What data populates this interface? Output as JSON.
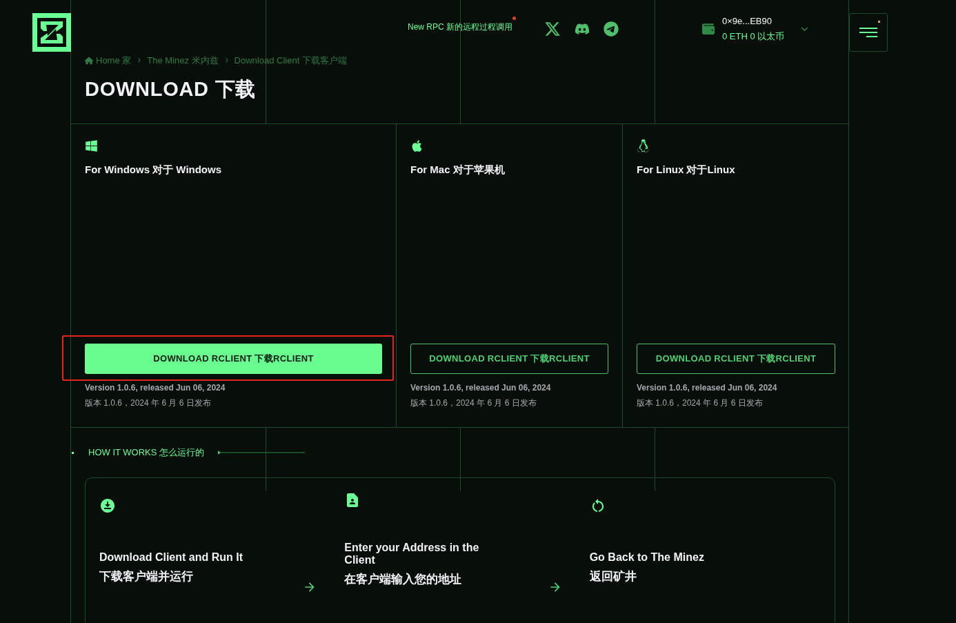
{
  "header": {
    "rpc_notice": "New RPC 新的远程过程调用",
    "rpc_notice_dot": true,
    "wallet": {
      "address": "0×9e...EB90",
      "balance": "0 ETH 0 以太币"
    },
    "menu_dot": true
  },
  "breadcrumb": [
    {
      "label": "Home 家",
      "home": true
    },
    {
      "label": "The Minez 米内兹",
      "home": false
    },
    {
      "label": "Download Client 下载客户端",
      "home": false
    }
  ],
  "page_title": "DOWNLOAD 下载",
  "platforms": [
    {
      "kind": "windows",
      "title": "For Windows 对于 Windows",
      "button": "DOWNLOAD RCLIENT 下载RCLIENT",
      "primary": true,
      "highlighted": true,
      "version": "Version 1.0.6, released Jun 06, 2024",
      "version_cn": "版本 1.0.6，2024 年 6 月 6 日发布"
    },
    {
      "kind": "mac",
      "title": "For Mac 对于苹果机",
      "button": "DOWNLOAD RCLIENT 下载RCLIENT",
      "primary": false,
      "highlighted": false,
      "version": "Version 1.0.6, released Jun 06, 2024",
      "version_cn": "版本 1.0.6，2024 年 6 月 6 日发布"
    },
    {
      "kind": "linux",
      "title": "For Linux 对于Linux",
      "button": "DOWNLOAD RCLIENT 下载RCLIENT",
      "primary": false,
      "highlighted": false,
      "version": "Version 1.0.6, released Jun 06, 2024",
      "version_cn": "版本 1.0.6，2024 年 6 月 6 日发布"
    }
  ],
  "how_it_works": {
    "label": "HOW IT WORKS 怎么运行的",
    "steps": [
      {
        "kind": "download",
        "title": "Download Client and Run It",
        "title_cn": "下载客户端并运行",
        "arrow": true
      },
      {
        "kind": "address",
        "title": "Enter your Address in the Client",
        "title_cn": "在客户端输入您的地址",
        "arrow": true
      },
      {
        "kind": "return",
        "title": "Go Back to The Minez",
        "title_cn": "返回矿井",
        "arrow": false
      }
    ]
  }
}
